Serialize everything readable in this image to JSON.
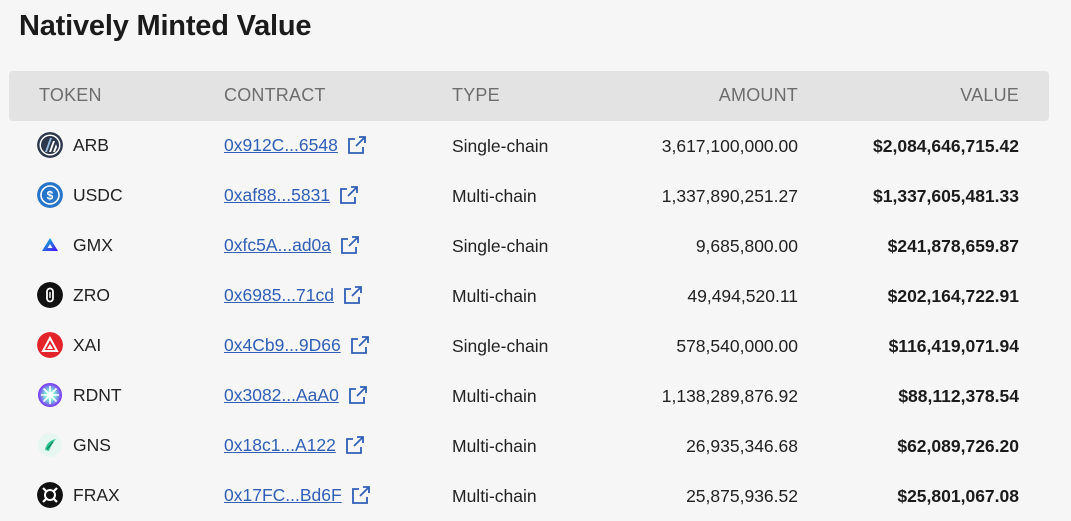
{
  "title": "Natively Minted Value",
  "columns": {
    "token": "TOKEN",
    "contract": "CONTRACT",
    "type": "TYPE",
    "amount": "AMOUNT",
    "value": "VALUE"
  },
  "rows": [
    {
      "token": "ARB",
      "icon": "arbitrum-icon",
      "contract": "0x912C...6548",
      "type": "Single-chain",
      "amount": "3,617,100,000.00",
      "value": "$2,084,646,715.42"
    },
    {
      "token": "USDC",
      "icon": "usdc-icon",
      "contract": "0xaf88...5831",
      "type": "Multi-chain",
      "amount": "1,337,890,251.27",
      "value": "$1,337,605,481.33"
    },
    {
      "token": "GMX",
      "icon": "gmx-icon",
      "contract": "0xfc5A...ad0a",
      "type": "Single-chain",
      "amount": "9,685,800.00",
      "value": "$241,878,659.87"
    },
    {
      "token": "ZRO",
      "icon": "layerzero-icon",
      "contract": "0x6985...71cd",
      "type": "Multi-chain",
      "amount": "49,494,520.11",
      "value": "$202,164,722.91"
    },
    {
      "token": "XAI",
      "icon": "xai-icon",
      "contract": "0x4Cb9...9D66",
      "type": "Single-chain",
      "amount": "578,540,000.00",
      "value": "$116,419,071.94"
    },
    {
      "token": "RDNT",
      "icon": "radiant-icon",
      "contract": "0x3082...AaA0",
      "type": "Multi-chain",
      "amount": "1,138,289,876.92",
      "value": "$88,112,378.54"
    },
    {
      "token": "GNS",
      "icon": "gns-icon",
      "contract": "0x18c1...A122",
      "type": "Multi-chain",
      "amount": "26,935,346.68",
      "value": "$62,089,726.20"
    },
    {
      "token": "FRAX",
      "icon": "frax-icon",
      "contract": "0x17FC...Bd6F",
      "type": "Multi-chain",
      "amount": "25,875,936.52",
      "value": "$25,801,067.08"
    }
  ]
}
